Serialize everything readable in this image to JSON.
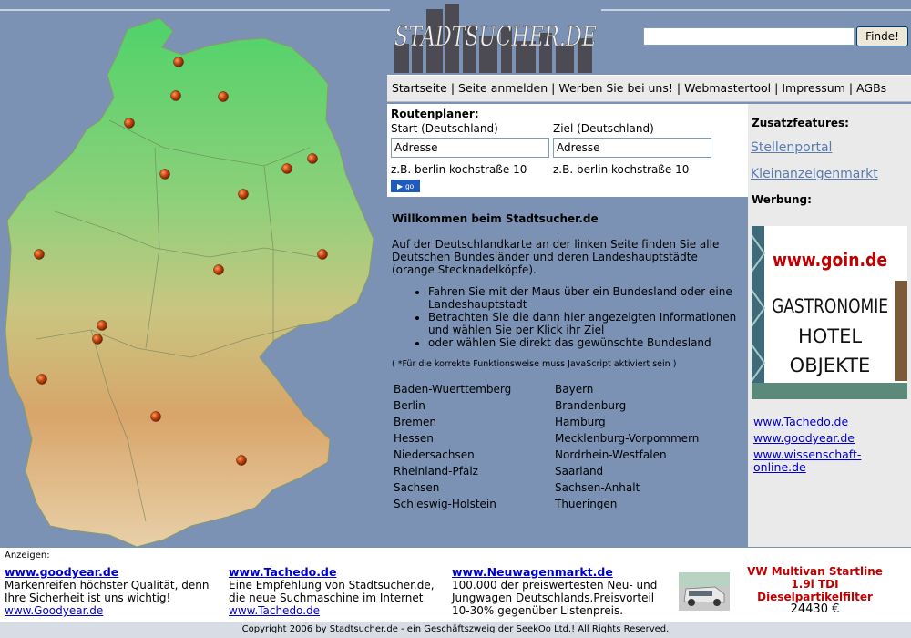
{
  "brand": {
    "logo_text": "STADTSUCHER.DE"
  },
  "search": {
    "value": "",
    "button_label": "Finde!"
  },
  "nav": {
    "items": [
      "Startseite",
      "Seite anmelden",
      "Werben Sie bei uns!",
      "Webmastertool",
      "Impressum",
      "AGBs"
    ],
    "separator": "|"
  },
  "route": {
    "title": "Routenplaner:",
    "start_label": "Start (Deutschland)",
    "start_value": "Adresse",
    "start_example": "z.B. berlin kochstraße 10",
    "ziel_label": "Ziel (Deutschland)",
    "ziel_value": "Adresse",
    "ziel_example": "z.B. berlin kochstraße 10",
    "go_label": "go"
  },
  "welcome": {
    "title": "Willkommen beim Stadtsucher.de",
    "intro": "Auf der Deutschlandkarte an der linken Seite finden Sie alle Deutschen Bundesländer und deren Landeshauptstädte (orange Stecknadelköpfe).",
    "bullets": [
      "Fahren Sie mit der Maus über ein Bundesland oder eine Landeshauptstadt",
      "Betrachten Sie die dann hier angezeigten Informationen und wählen Sie per Klick ihr Ziel",
      "oder wählen Sie direkt das gewünschte Bundesland"
    ],
    "js_note": "( *Für die korrekte Funktionsweise muss JavaScript aktiviert sein )"
  },
  "states": {
    "left": [
      "Baden-Wuerttemberg",
      "Berlin",
      "Bremen",
      "Hessen",
      "Niedersachsen",
      "Rheinland-Pfalz",
      "Sachsen",
      "Schleswig-Holstein"
    ],
    "right": [
      "Bayern",
      "Brandenburg",
      "Hamburg",
      "Mecklenburg-Vorpommern",
      "Nordrhein-Westfalen",
      "Saarland",
      "Sachsen-Anhalt",
      "Thueringen"
    ]
  },
  "sidebar": {
    "features_title": "Zusatzfeatures:",
    "feature_links": [
      "Stellenportal",
      "Kleinanzeigenmarkt"
    ],
    "werbung_title": "Werbung:",
    "ad": {
      "url": "www.goin.de",
      "lines": [
        "GASTRONOMIE",
        "HOTEL",
        "OBJEKTE"
      ]
    },
    "links": [
      "www.Tachedo.de",
      "www.goodyear.de",
      "www.wissenschaft-online.de"
    ]
  },
  "bottom": {
    "label": "Anzeigen:",
    "ads": [
      {
        "title": "www.goodyear.de",
        "text": "Markenreifen höchster Qualität, denn Ihre Sicherheit ist uns wichtig!",
        "link": "www.Goodyear.de"
      },
      {
        "title": "www.Tachedo.de",
        "text": "Eine Empfehlung von Stadtsucher.de, die neue Suchmaschine im Internet",
        "link": "www.Tachedo.de"
      },
      {
        "title": "www.Neuwagenmarkt.de",
        "text": "100.000 der preiswertesten Neu- und Jungwagen Deutschlands.Preisvorteil 10-30% gegenüber Listenpreis.",
        "link": ""
      }
    ],
    "car_ad": {
      "line1": "VW Multivan Startline",
      "line2": "1.9l TDI",
      "line3": "Dieselpartikelfilter",
      "price": "24430 €"
    }
  },
  "footer": {
    "text": "Copyright 2006 by Stadtsucher.de - ein Geschäftszweig der SeekOo Ltd.! All Rights Reserved."
  },
  "colors": {
    "page_bg": "#7b92b5",
    "panel_bg": "#eaeaea",
    "link": "#0000cc",
    "pin": "#b8420f",
    "go_button": "#1f5bbf",
    "ad_red": "#c00000"
  }
}
